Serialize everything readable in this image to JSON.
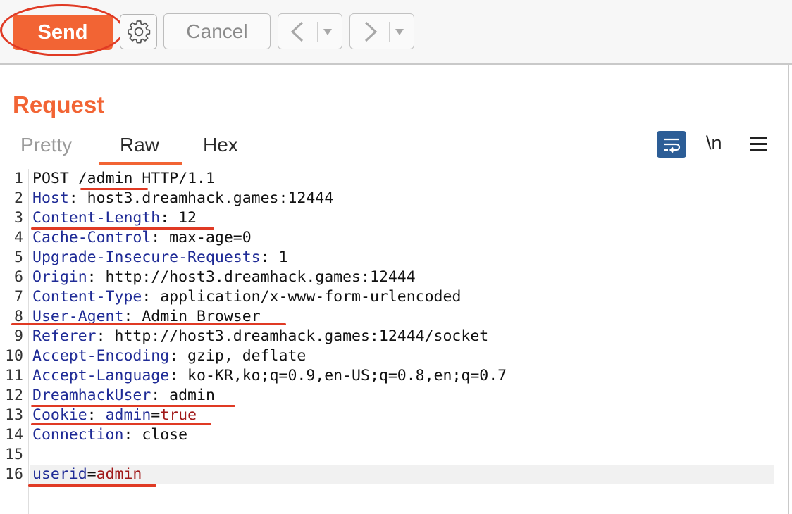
{
  "toolbar": {
    "send_label": "Send",
    "cancel_label": "Cancel",
    "back_icon": "chevron-left-icon",
    "forward_icon": "chevron-right-icon",
    "settings_icon": "gear-icon"
  },
  "request": {
    "title": "Request",
    "tabs": [
      {
        "label": "Pretty"
      },
      {
        "label": "Raw"
      },
      {
        "label": "Hex"
      }
    ],
    "active_tab": "Raw",
    "newline_label": "\\n",
    "lines": [
      {
        "num": "1",
        "parts": [
          {
            "t": "POST "
          },
          {
            "t": "/admin"
          },
          {
            "t": " HTTP/1.1"
          }
        ]
      },
      {
        "num": "2",
        "parts": [
          {
            "t": "Host",
            "c": "k"
          },
          {
            "t": ": host3.dreamhack.games:12444"
          }
        ]
      },
      {
        "num": "3",
        "parts": [
          {
            "t": "Content-Length",
            "c": "k"
          },
          {
            "t": ": 12"
          }
        ]
      },
      {
        "num": "4",
        "parts": [
          {
            "t": "Cache-Control",
            "c": "k"
          },
          {
            "t": ": max-age=0"
          }
        ]
      },
      {
        "num": "5",
        "parts": [
          {
            "t": "Upgrade-Insecure-Requests",
            "c": "k"
          },
          {
            "t": ": 1"
          }
        ]
      },
      {
        "num": "6",
        "parts": [
          {
            "t": "Origin",
            "c": "k"
          },
          {
            "t": ": http://host3.dreamhack.games:12444"
          }
        ]
      },
      {
        "num": "7",
        "parts": [
          {
            "t": "Content-Type",
            "c": "k"
          },
          {
            "t": ": application/x-www-form-urlencoded"
          }
        ]
      },
      {
        "num": "8",
        "parts": [
          {
            "t": "User-Agent",
            "c": "k"
          },
          {
            "t": ": Admin Browser"
          }
        ]
      },
      {
        "num": "9",
        "parts": [
          {
            "t": "Referer",
            "c": "k"
          },
          {
            "t": ": http://host3.dreamhack.games:12444/socket"
          }
        ]
      },
      {
        "num": "10",
        "parts": [
          {
            "t": "Accept-Encoding",
            "c": "k"
          },
          {
            "t": ": gzip, deflate"
          }
        ]
      },
      {
        "num": "11",
        "parts": [
          {
            "t": "Accept-Language",
            "c": "k"
          },
          {
            "t": ": ko-KR,ko;q=0.9,en-US;q=0.8,en;q=0.7"
          }
        ]
      },
      {
        "num": "12",
        "parts": [
          {
            "t": "DreamhackUser",
            "c": "k"
          },
          {
            "t": ": admin"
          }
        ]
      },
      {
        "num": "13",
        "parts": [
          {
            "t": "Cookie",
            "c": "k"
          },
          {
            "t": ": "
          },
          {
            "t": "admin",
            "c": "k"
          },
          {
            "t": "="
          },
          {
            "t": "true",
            "c": "pv"
          }
        ]
      },
      {
        "num": "14",
        "parts": [
          {
            "t": "Connection",
            "c": "k"
          },
          {
            "t": ": close"
          }
        ]
      },
      {
        "num": "15",
        "parts": []
      },
      {
        "num": "16",
        "parts": [
          {
            "t": "userid",
            "c": "k"
          },
          {
            "t": "="
          },
          {
            "t": "admin",
            "c": "pv"
          }
        ]
      }
    ]
  },
  "colors": {
    "accent": "#f26434",
    "annotation": "#e03a24",
    "header_name": "#1f2b96",
    "param_value": "#a01818",
    "wrap_button": "#2c5d96"
  }
}
